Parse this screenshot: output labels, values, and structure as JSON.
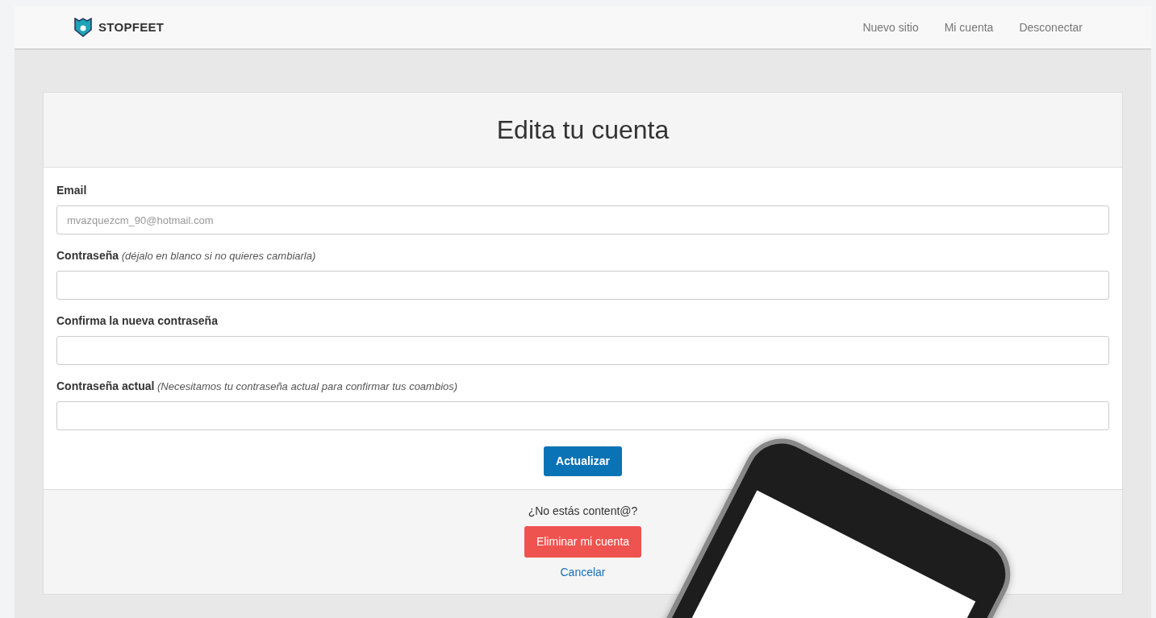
{
  "navbar": {
    "brand": "STOPFEET",
    "links": [
      {
        "label": "Nuevo sitio"
      },
      {
        "label": "Mi cuenta"
      },
      {
        "label": "Desconectar"
      }
    ]
  },
  "card": {
    "title": "Edita tu cuenta",
    "fields": [
      {
        "label": "Email",
        "value": "mvazquezcm_90@hotmail.com"
      },
      {
        "label": "Contraseña",
        "note": "(déjalo en blanco si no quieres cambiarla)"
      },
      {
        "label": "Confirma la nueva contraseña"
      },
      {
        "label": "Contraseña actual",
        "note": "(Necesitamos tu contraseña actual para confirmar tus coambios)"
      }
    ],
    "submit": "Actualizar",
    "footer": {
      "question": "¿No estás content@?",
      "delete": "Eliminar mi cuenta",
      "cancel": "Cancelar"
    }
  }
}
